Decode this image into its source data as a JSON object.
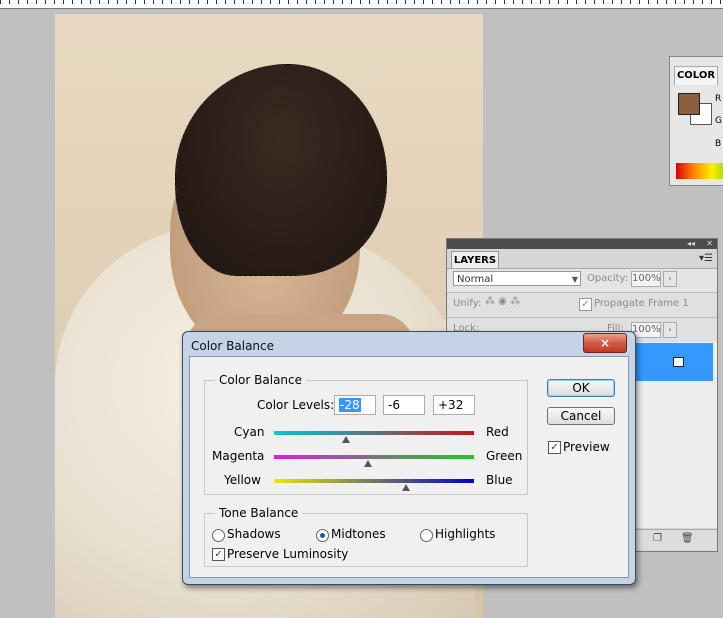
{
  "canvas": {
    "alt": ""
  },
  "color_panel": {
    "tab": "COLOR",
    "r": "R",
    "g": "G",
    "b": "B",
    "fg_color": "#8b5e3c",
    "bg_color": "#ffffff"
  },
  "layers_panel": {
    "tab": "LAYERS",
    "blend_mode": "Normal",
    "opacity_label": "Opacity:",
    "opacity_value": "100%",
    "unify_label": "Unify:",
    "propagate_label": "Propagate Frame 1",
    "lock_label": "Lock:",
    "fill_label": "Fill:",
    "fill_value": "100%"
  },
  "dialog": {
    "title": "Color Balance",
    "close": "×",
    "color_balance_group": "Color Balance",
    "color_levels_label": "Color Levels:",
    "levels": [
      "-28",
      "-6",
      "+32"
    ],
    "sliders": [
      {
        "left": "Cyan",
        "right": "Red",
        "value": -28
      },
      {
        "left": "Magenta",
        "right": "Green",
        "value": -6
      },
      {
        "left": "Yellow",
        "right": "Blue",
        "value": 32
      }
    ],
    "ok_label": "OK",
    "cancel_label": "Cancel",
    "preview_label": "Preview",
    "preview_checked": true,
    "tone_group": "Tone Balance",
    "tones": [
      "Shadows",
      "Midtones",
      "Highlights"
    ],
    "selected_tone": "Midtones",
    "preserve_label": "Preserve Luminosity",
    "preserve_checked": true
  }
}
